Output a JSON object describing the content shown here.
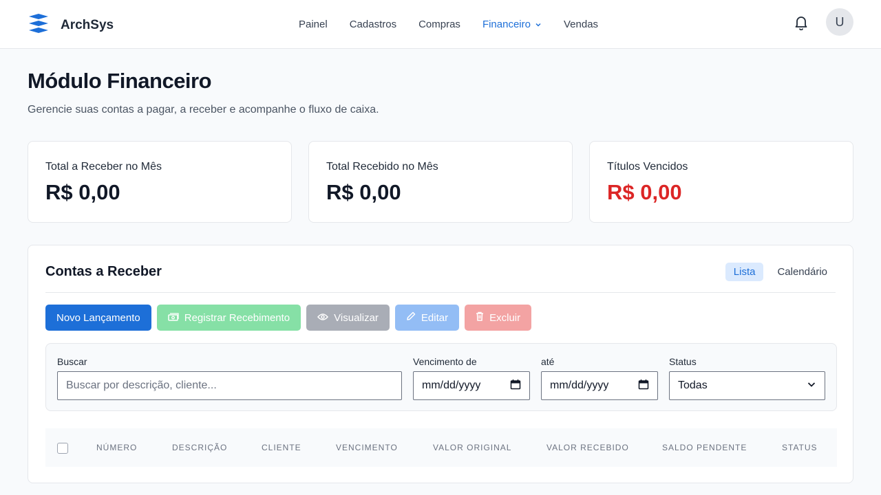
{
  "app": {
    "name": "ArchSys",
    "avatar_initial": "U"
  },
  "nav": [
    {
      "label": "Painel"
    },
    {
      "label": "Cadastros"
    },
    {
      "label": "Compras"
    },
    {
      "label": "Financeiro",
      "active": true,
      "has_dropdown": true
    },
    {
      "label": "Vendas"
    }
  ],
  "page": {
    "title": "Módulo Financeiro",
    "subtitle": "Gerencie suas contas a pagar, a receber e acompanhe o fluxo de caixa."
  },
  "cards": [
    {
      "label": "Total a Receber no Mês",
      "value": "R$ 0,00"
    },
    {
      "label": "Total Recebido no Mês",
      "value": "R$ 0,00"
    },
    {
      "label": "Títulos Vencidos",
      "value": "R$ 0,00",
      "color": "#dc2626"
    }
  ],
  "panel": {
    "title": "Contas a Receber",
    "views": [
      {
        "label": "Lista",
        "active": true
      },
      {
        "label": "Calendário"
      }
    ],
    "actions": {
      "new": "Novo Lançamento",
      "register": "Registrar Recebimento",
      "view": "Visualizar",
      "edit": "Editar",
      "delete": "Excluir"
    },
    "filters": {
      "search_label": "Buscar",
      "search_placeholder": "Buscar por descrição, cliente...",
      "due_from_label": "Vencimento de",
      "due_from_value": "mm/dd/yyyy",
      "due_to_label": "até",
      "due_to_value": "mm/dd/yyyy",
      "status_label": "Status",
      "status_value": "Todas"
    },
    "columns": [
      "NÚMERO",
      "DESCRIÇÃO",
      "CLIENTE",
      "VENCIMENTO",
      "VALOR ORIGINAL",
      "VALOR RECEBIDO",
      "SALDO PENDENTE",
      "STATUS"
    ]
  },
  "colors": {
    "accent": "#1d6fd8",
    "danger": "#dc2626"
  },
  "icons": [
    "logo-stack-icon",
    "chevron-down-icon",
    "bell-icon",
    "money-icon",
    "eye-icon",
    "pencil-icon",
    "trash-icon",
    "calendar-icon"
  ]
}
